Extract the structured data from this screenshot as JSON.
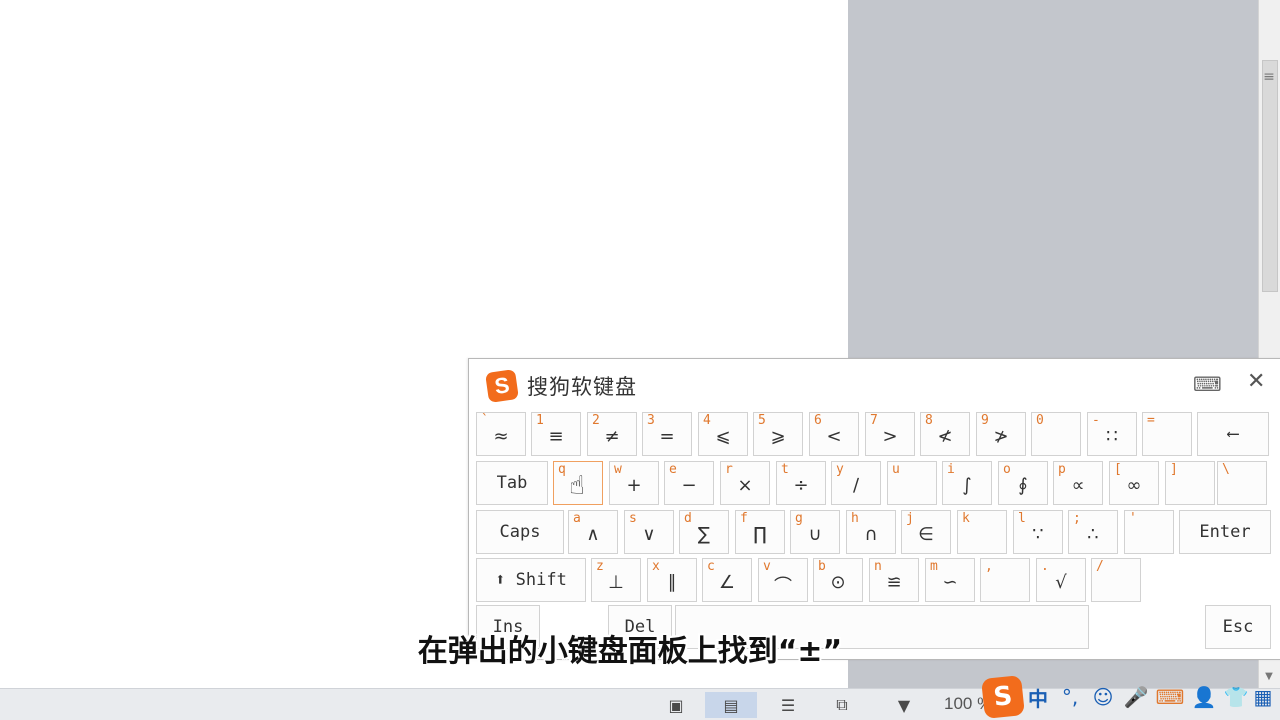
{
  "keyboard": {
    "title": "搜狗软键盘",
    "logo": "S",
    "rows": [
      [
        {
          "main": "`",
          "sym": "≈"
        },
        {
          "main": "1",
          "sym": "≡"
        },
        {
          "main": "2",
          "sym": "≠"
        },
        {
          "main": "3",
          "sym": "="
        },
        {
          "main": "4",
          "sym": "⩽"
        },
        {
          "main": "5",
          "sym": "⩾"
        },
        {
          "main": "6",
          "sym": "<"
        },
        {
          "main": "7",
          "sym": ">"
        },
        {
          "main": "8",
          "sym": "≮"
        },
        {
          "main": "9",
          "sym": "≯"
        },
        {
          "main": "0",
          "sym": ""
        },
        {
          "main": "-",
          "sym": "∷"
        },
        {
          "main": "=",
          "sym": ""
        },
        {
          "label": "⟵"
        }
      ],
      [
        {
          "label": "Tab"
        },
        {
          "main": "q",
          "sym": ""
        },
        {
          "main": "w",
          "sym": "+"
        },
        {
          "main": "e",
          "sym": "−"
        },
        {
          "main": "r",
          "sym": "×"
        },
        {
          "main": "t",
          "sym": "÷"
        },
        {
          "main": "y",
          "sym": "∕"
        },
        {
          "main": "u",
          "sym": ""
        },
        {
          "main": "i",
          "sym": "∫"
        },
        {
          "main": "o",
          "sym": "∮"
        },
        {
          "main": "p",
          "sym": "∝"
        },
        {
          "main": "[",
          "sym": "∞"
        },
        {
          "main": "]",
          "sym": ""
        },
        {
          "main": "\\",
          "sym": ""
        }
      ],
      [
        {
          "label": "Caps"
        },
        {
          "main": "a",
          "sym": "∧"
        },
        {
          "main": "s",
          "sym": "∨"
        },
        {
          "main": "d",
          "sym": "∑"
        },
        {
          "main": "f",
          "sym": "∏"
        },
        {
          "main": "g",
          "sym": "∪"
        },
        {
          "main": "h",
          "sym": "∩"
        },
        {
          "main": "j",
          "sym": "∈"
        },
        {
          "main": "k",
          "sym": ""
        },
        {
          "main": "l",
          "sym": "∵"
        },
        {
          "main": ";",
          "sym": "∴"
        },
        {
          "main": "'",
          "sym": ""
        },
        {
          "label": "Enter"
        }
      ],
      [
        {
          "label": "⬆ Shift"
        },
        {
          "main": "z",
          "sym": "⊥"
        },
        {
          "main": "x",
          "sym": "∥"
        },
        {
          "main": "c",
          "sym": "∠"
        },
        {
          "main": "v",
          "sym": "⌒"
        },
        {
          "main": "b",
          "sym": "⊙"
        },
        {
          "main": "n",
          "sym": "≌"
        },
        {
          "main": "m",
          "sym": "∽"
        },
        {
          "main": ",",
          "sym": ""
        },
        {
          "main": ".",
          "sym": "√"
        },
        {
          "main": "/",
          "sym": ""
        }
      ],
      [
        {
          "label": "Ins"
        },
        {
          "label": "Del"
        },
        {
          "label": ""
        },
        {
          "label": "Esc"
        }
      ]
    ]
  },
  "subtitle": "在弹出的小键盘面板上找到“±”",
  "statusbar": {
    "zoom": "100 %"
  },
  "ime": {
    "logo": "S",
    "mode": "中",
    "punct": "°,"
  }
}
